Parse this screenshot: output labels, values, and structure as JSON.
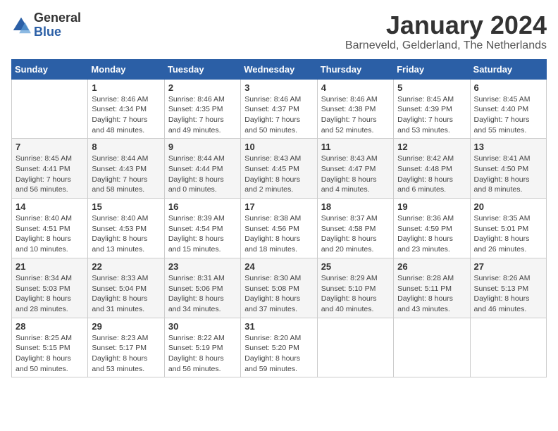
{
  "logo": {
    "general": "General",
    "blue": "Blue"
  },
  "header": {
    "month": "January 2024",
    "location": "Barneveld, Gelderland, The Netherlands"
  },
  "columns": [
    "Sunday",
    "Monday",
    "Tuesday",
    "Wednesday",
    "Thursday",
    "Friday",
    "Saturday"
  ],
  "weeks": [
    [
      {
        "day": "",
        "info": ""
      },
      {
        "day": "1",
        "info": "Sunrise: 8:46 AM\nSunset: 4:34 PM\nDaylight: 7 hours\nand 48 minutes."
      },
      {
        "day": "2",
        "info": "Sunrise: 8:46 AM\nSunset: 4:35 PM\nDaylight: 7 hours\nand 49 minutes."
      },
      {
        "day": "3",
        "info": "Sunrise: 8:46 AM\nSunset: 4:37 PM\nDaylight: 7 hours\nand 50 minutes."
      },
      {
        "day": "4",
        "info": "Sunrise: 8:46 AM\nSunset: 4:38 PM\nDaylight: 7 hours\nand 52 minutes."
      },
      {
        "day": "5",
        "info": "Sunrise: 8:45 AM\nSunset: 4:39 PM\nDaylight: 7 hours\nand 53 minutes."
      },
      {
        "day": "6",
        "info": "Sunrise: 8:45 AM\nSunset: 4:40 PM\nDaylight: 7 hours\nand 55 minutes."
      }
    ],
    [
      {
        "day": "7",
        "info": "Sunrise: 8:45 AM\nSunset: 4:41 PM\nDaylight: 7 hours\nand 56 minutes."
      },
      {
        "day": "8",
        "info": "Sunrise: 8:44 AM\nSunset: 4:43 PM\nDaylight: 7 hours\nand 58 minutes."
      },
      {
        "day": "9",
        "info": "Sunrise: 8:44 AM\nSunset: 4:44 PM\nDaylight: 8 hours\nand 0 minutes."
      },
      {
        "day": "10",
        "info": "Sunrise: 8:43 AM\nSunset: 4:45 PM\nDaylight: 8 hours\nand 2 minutes."
      },
      {
        "day": "11",
        "info": "Sunrise: 8:43 AM\nSunset: 4:47 PM\nDaylight: 8 hours\nand 4 minutes."
      },
      {
        "day": "12",
        "info": "Sunrise: 8:42 AM\nSunset: 4:48 PM\nDaylight: 8 hours\nand 6 minutes."
      },
      {
        "day": "13",
        "info": "Sunrise: 8:41 AM\nSunset: 4:50 PM\nDaylight: 8 hours\nand 8 minutes."
      }
    ],
    [
      {
        "day": "14",
        "info": "Sunrise: 8:40 AM\nSunset: 4:51 PM\nDaylight: 8 hours\nand 10 minutes."
      },
      {
        "day": "15",
        "info": "Sunrise: 8:40 AM\nSunset: 4:53 PM\nDaylight: 8 hours\nand 13 minutes."
      },
      {
        "day": "16",
        "info": "Sunrise: 8:39 AM\nSunset: 4:54 PM\nDaylight: 8 hours\nand 15 minutes."
      },
      {
        "day": "17",
        "info": "Sunrise: 8:38 AM\nSunset: 4:56 PM\nDaylight: 8 hours\nand 18 minutes."
      },
      {
        "day": "18",
        "info": "Sunrise: 8:37 AM\nSunset: 4:58 PM\nDaylight: 8 hours\nand 20 minutes."
      },
      {
        "day": "19",
        "info": "Sunrise: 8:36 AM\nSunset: 4:59 PM\nDaylight: 8 hours\nand 23 minutes."
      },
      {
        "day": "20",
        "info": "Sunrise: 8:35 AM\nSunset: 5:01 PM\nDaylight: 8 hours\nand 26 minutes."
      }
    ],
    [
      {
        "day": "21",
        "info": "Sunrise: 8:34 AM\nSunset: 5:03 PM\nDaylight: 8 hours\nand 28 minutes."
      },
      {
        "day": "22",
        "info": "Sunrise: 8:33 AM\nSunset: 5:04 PM\nDaylight: 8 hours\nand 31 minutes."
      },
      {
        "day": "23",
        "info": "Sunrise: 8:31 AM\nSunset: 5:06 PM\nDaylight: 8 hours\nand 34 minutes."
      },
      {
        "day": "24",
        "info": "Sunrise: 8:30 AM\nSunset: 5:08 PM\nDaylight: 8 hours\nand 37 minutes."
      },
      {
        "day": "25",
        "info": "Sunrise: 8:29 AM\nSunset: 5:10 PM\nDaylight: 8 hours\nand 40 minutes."
      },
      {
        "day": "26",
        "info": "Sunrise: 8:28 AM\nSunset: 5:11 PM\nDaylight: 8 hours\nand 43 minutes."
      },
      {
        "day": "27",
        "info": "Sunrise: 8:26 AM\nSunset: 5:13 PM\nDaylight: 8 hours\nand 46 minutes."
      }
    ],
    [
      {
        "day": "28",
        "info": "Sunrise: 8:25 AM\nSunset: 5:15 PM\nDaylight: 8 hours\nand 50 minutes."
      },
      {
        "day": "29",
        "info": "Sunrise: 8:23 AM\nSunset: 5:17 PM\nDaylight: 8 hours\nand 53 minutes."
      },
      {
        "day": "30",
        "info": "Sunrise: 8:22 AM\nSunset: 5:19 PM\nDaylight: 8 hours\nand 56 minutes."
      },
      {
        "day": "31",
        "info": "Sunrise: 8:20 AM\nSunset: 5:20 PM\nDaylight: 8 hours\nand 59 minutes."
      },
      {
        "day": "",
        "info": ""
      },
      {
        "day": "",
        "info": ""
      },
      {
        "day": "",
        "info": ""
      }
    ]
  ]
}
